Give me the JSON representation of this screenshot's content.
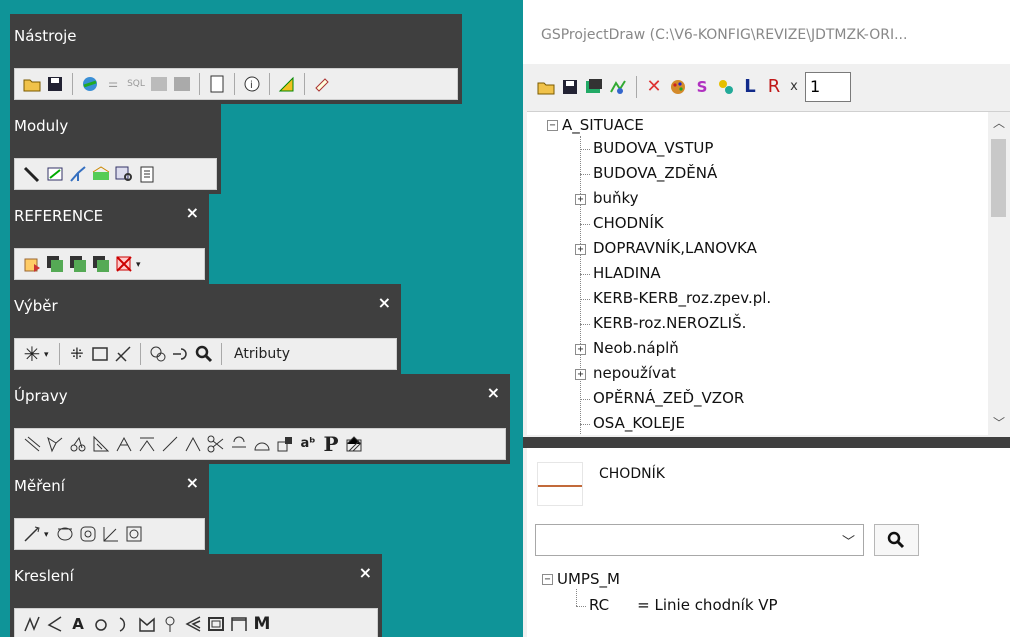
{
  "toolbars": {
    "nastroje": {
      "title": "Nástroje"
    },
    "moduly": {
      "title": "Moduly"
    },
    "reference": {
      "title": "REFERENCE",
      "close": "×"
    },
    "vyber": {
      "title": "Výběr",
      "close": "×",
      "attr_button": "Atributy"
    },
    "upravy": {
      "title": "Úpravy",
      "close": "×"
    },
    "mereni": {
      "title": "Měření",
      "close": "×"
    },
    "kresleni": {
      "title": "Kreslení",
      "close": "×"
    }
  },
  "panel": {
    "title": "GSProjectDraw (C:\\V6-KONFIG\\REVIZE\\JDTMZK-ORI...",
    "toolbar": {
      "s_label": "S",
      "l_label": "L",
      "r_label": "R",
      "x_label": "x",
      "zoom_value": "1"
    },
    "tree": {
      "root": "A_SITUACE",
      "items": [
        "BUDOVA_VSTUP",
        "BUDOVA_ZDĚNÁ",
        "buňky",
        "CHODNÍK",
        "DOPRAVNÍK,LANOVKA",
        "HLADINA",
        "KERB-KERB_roz.zpev.pl.",
        "KERB-roz.NEROZLIŠ.",
        "Neob.náplň",
        "nepoužívat",
        "OPĚRNÁ_ZEĎ_VZOR",
        "OSA_KOLEJE"
      ]
    },
    "detail": {
      "layer_name": "CHODNÍK",
      "root": "UMPS_M",
      "child_key": "RC",
      "child_value": "= Linie chodník VP"
    },
    "colors": {
      "line_swatch": "#c26a3a",
      "background": "#0f9498",
      "toolbar_frame": "#3f3f3f"
    }
  }
}
